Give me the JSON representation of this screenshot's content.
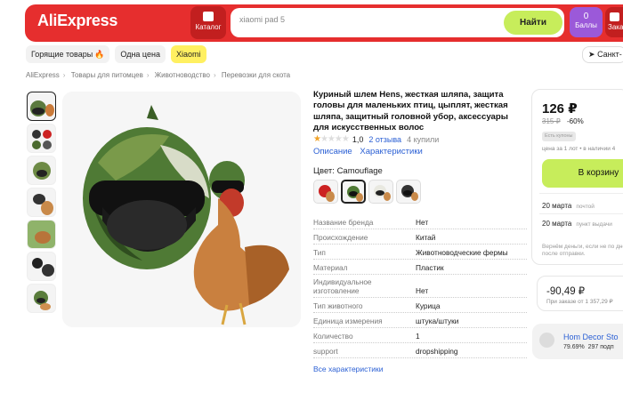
{
  "header": {
    "logo": "AliExpress",
    "catalog_label": "Каталог",
    "search_value": "xiaomi pad 5",
    "search_button": "Найти",
    "points_value": "0",
    "points_label": "Баллы",
    "orders_label": "Зака"
  },
  "chips": [
    {
      "label": "Горящие товары"
    },
    {
      "label": "Одна цена"
    },
    {
      "label": "Xiaomi"
    }
  ],
  "city": "Санкт-",
  "breadcrumbs": [
    "AliExpress",
    "Товары для питомцев",
    "Животноводство",
    "Перевозки для скота"
  ],
  "product": {
    "title": "Куриный шлем Hens, жесткая шляпа, защита головы для маленьких птиц, цыплят, жесткая шляпа, защитный головной убор, аксессуары для искусственных волос",
    "rating_value": "1,0",
    "reviews": "2 отзыва",
    "bought": "4 купили",
    "tab_description": "Описание",
    "tab_specs": "Характеристики",
    "color_label": "Цвет: Camouflage",
    "specs": [
      {
        "k": "Название бренда",
        "v": "Нет"
      },
      {
        "k": "Происхождение",
        "v": "Китай"
      },
      {
        "k": "Тип",
        "v": "Животноводческие фермы"
      },
      {
        "k": "Материал",
        "v": "Пластик"
      },
      {
        "k": "Индивидуальное изготовление",
        "v": "Нет"
      },
      {
        "k": "Тип животного",
        "v": "Курица"
      },
      {
        "k": "Единица измерения",
        "v": "штука/штуки"
      },
      {
        "k": "Количество",
        "v": "1"
      },
      {
        "k": "support",
        "v": "dropshipping"
      }
    ],
    "all_specs_link": "Все характеристики"
  },
  "buybox": {
    "price": "126 ₽",
    "old_price": "315 ₽",
    "discount": "-60%",
    "coupons_badge": "Есть купоны",
    "unit_price": "цена за 1 лот • в наличии 4",
    "cart_button": "В корзину",
    "delivery": [
      {
        "date": "20 марта",
        "type": "почтой"
      },
      {
        "date": "20 марта",
        "type": "пункт выдачи"
      }
    ],
    "refund_note": "Вернём деньги, если не по дней после отправки."
  },
  "coupon": {
    "value": "-90,49 ₽",
    "note": "При заказе от 1 357,29 ₽"
  },
  "store": {
    "name": "Hom Decor Sto",
    "rating": "79.69%",
    "stat": "297 подп"
  },
  "colors": {
    "brand_red": "#e62e2e",
    "accent_green": "#c7ed5b",
    "link_blue": "#2a5fd4",
    "chip_yellow": "#fff061",
    "points_purple": "#9b59d9"
  }
}
